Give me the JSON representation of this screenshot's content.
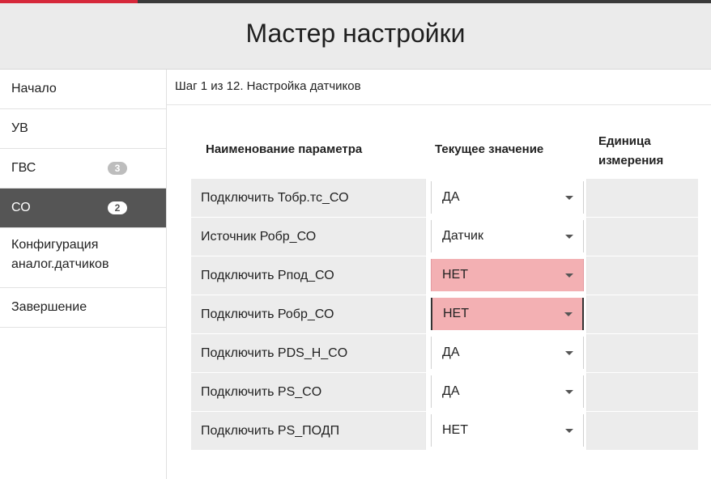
{
  "header": {
    "title": "Мастер настройки"
  },
  "sidebar": {
    "items": [
      {
        "label": "Начало",
        "badge": ""
      },
      {
        "label": "УВ",
        "badge": ""
      },
      {
        "label": "ГВС",
        "badge": "3"
      },
      {
        "label": "СО",
        "badge": "2"
      },
      {
        "label": "Конфигурация аналог.датчиков",
        "badge": ""
      },
      {
        "label": "Завершение",
        "badge": ""
      }
    ]
  },
  "main": {
    "step": "Шаг 1 из 12. Настройка датчиков",
    "columns": {
      "name": "Наименование параметра",
      "value": "Текущее значение",
      "unit": "Единица измерения"
    },
    "rows": [
      {
        "name": "Подключить Тобр.тс_СО",
        "value": "ДА",
        "unit": ""
      },
      {
        "name": "Источник Робр_СО",
        "value": "Датчик",
        "unit": ""
      },
      {
        "name": "Подключить Рпод_СО",
        "value": "НЕТ",
        "unit": ""
      },
      {
        "name": "Подключить Робр_СО",
        "value": "НЕТ",
        "unit": ""
      },
      {
        "name": "Подключить PDS_H_CO",
        "value": "ДА",
        "unit": ""
      },
      {
        "name": "Подключить PS_CO",
        "value": "ДА",
        "unit": ""
      },
      {
        "name": "Подключить PS_ПОДП",
        "value": "НЕТ",
        "unit": ""
      }
    ]
  },
  "colors": {
    "active_nav": "#555555",
    "warning_value": "#f3b0b3",
    "brand": "#d6283a"
  },
  "icons": {
    "dropdown": "caret-down-icon"
  }
}
